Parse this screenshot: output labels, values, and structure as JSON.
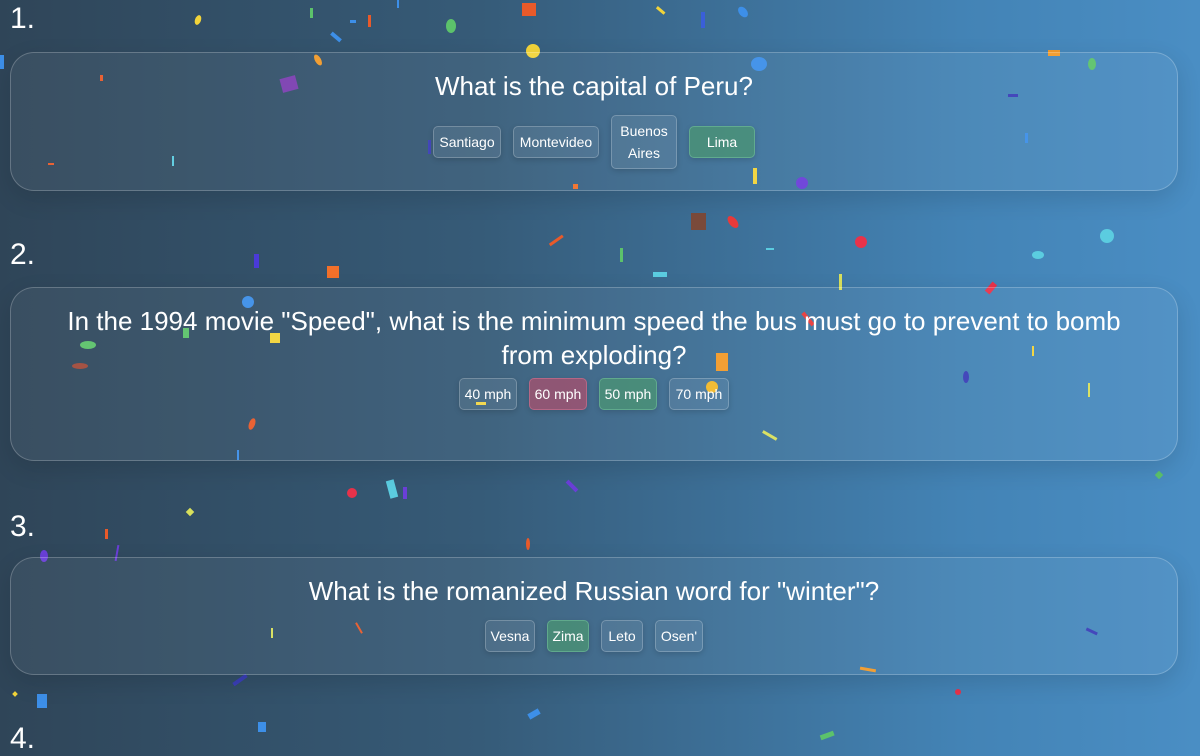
{
  "questions": [
    {
      "number": "1.",
      "text": "What is the capital of Peru?",
      "options": [
        {
          "label": "Santiago",
          "state": "neutral"
        },
        {
          "label": "Montevideo",
          "state": "neutral"
        },
        {
          "label": "Buenos Aires",
          "state": "neutral"
        },
        {
          "label": "Lima",
          "state": "correct"
        }
      ]
    },
    {
      "number": "2.",
      "text": "In the 1994 movie \"Speed\", what is the minimum speed the bus must go to prevent to bomb from exploding?",
      "options": [
        {
          "label": "40 mph",
          "state": "neutral"
        },
        {
          "label": "60 mph",
          "state": "wrong"
        },
        {
          "label": "50 mph",
          "state": "correct"
        },
        {
          "label": "70 mph",
          "state": "neutral"
        }
      ]
    },
    {
      "number": "3.",
      "text": "What is the romanized Russian word for \"winter\"?",
      "options": [
        {
          "label": "Vesna",
          "state": "neutral"
        },
        {
          "label": "Zima",
          "state": "correct"
        },
        {
          "label": "Leto",
          "state": "neutral"
        },
        {
          "label": "Osen'",
          "state": "neutral"
        }
      ]
    },
    {
      "number": "4."
    }
  ],
  "theme": {
    "correct_color": "#4b9673",
    "wrong_color": "#aa506e"
  }
}
